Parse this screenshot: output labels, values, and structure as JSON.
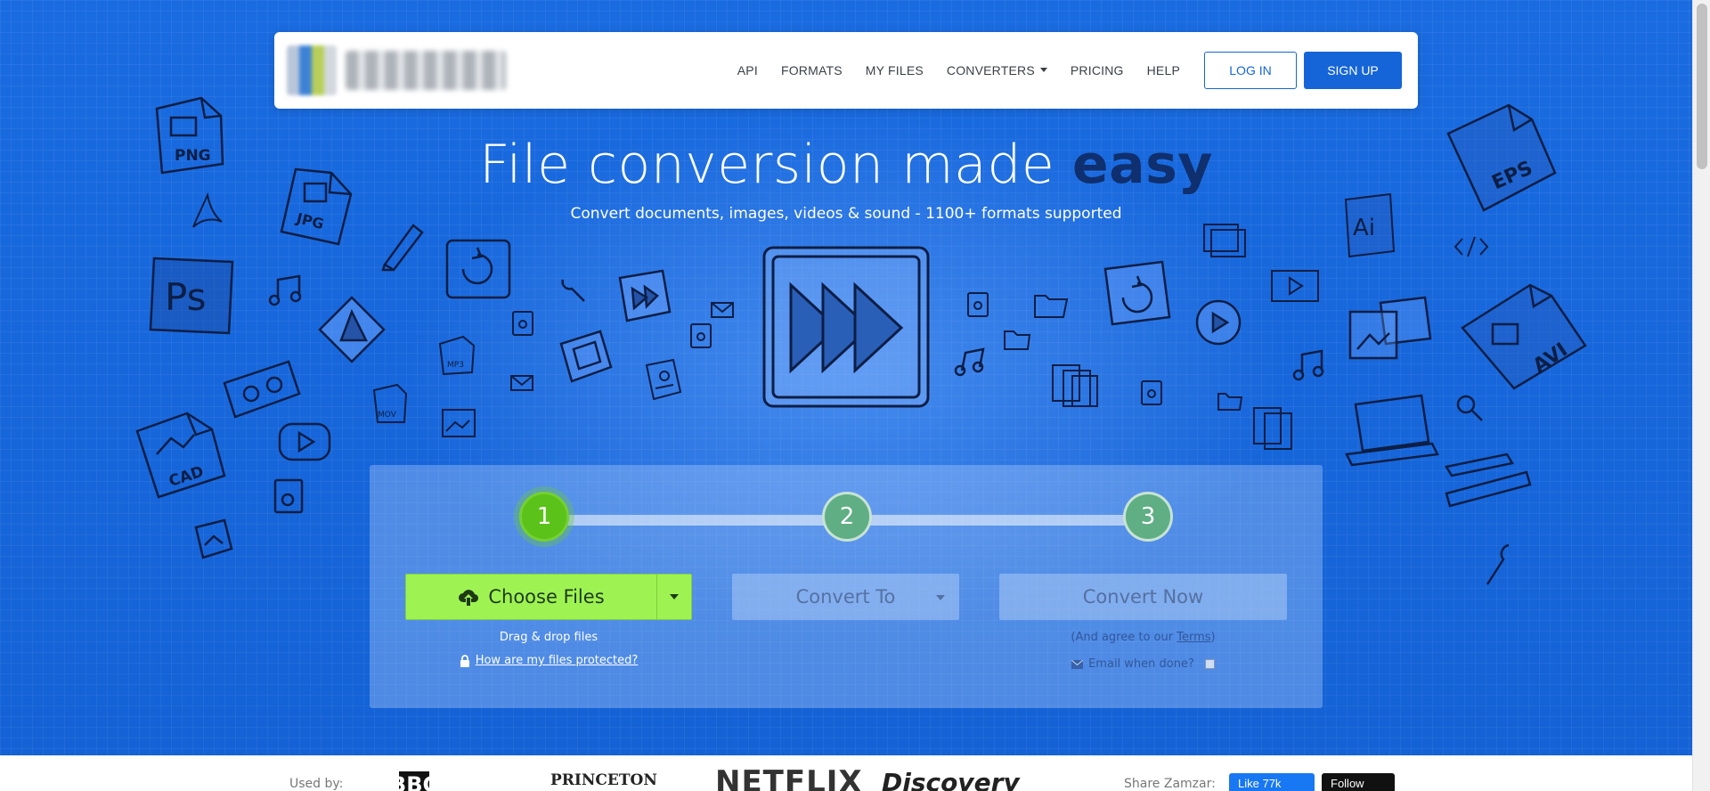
{
  "nav": {
    "links": [
      {
        "label": "API"
      },
      {
        "label": "FORMATS"
      },
      {
        "label": "MY FILES"
      },
      {
        "label": "CONVERTERS"
      },
      {
        "label": "PRICING"
      },
      {
        "label": "HELP"
      }
    ],
    "login_label": "LOG IN",
    "signup_label": "SIGN UP"
  },
  "hero": {
    "headline_main": "File conversion made",
    "headline_emphasis": "easy",
    "subheadline": "Convert documents, images, videos & sound - 1100+ formats supported"
  },
  "doodles": {
    "png": "PNG",
    "jpg": "JPG",
    "ps": "Ps",
    "cad": "CAD",
    "eps": "EPS",
    "ai": "Ai",
    "avi": "AVI",
    "mp3": "MP3",
    "mov": "MOV"
  },
  "converter": {
    "steps": [
      "1",
      "2",
      "3"
    ],
    "choose_files_label": "Choose Files",
    "convert_to_label": "Convert To",
    "convert_now_label": "Convert Now",
    "drag_drop_text": "Drag & drop files",
    "protection_link": "How are my files protected?",
    "agree_prefix": "(And agree to our ",
    "terms_label": "Terms",
    "agree_suffix": ")",
    "email_label": "Email when done?"
  },
  "strip": {
    "used_by_label": "Used by:",
    "brands": [
      "BBC",
      "PRINCETON",
      "NETFLIX",
      "Discovery"
    ],
    "share_label": "Share Zamzar:",
    "fb_like_label": "Like 77k",
    "x_follow_label": "Follow"
  },
  "colors": {
    "brand_blue": "#1565d8",
    "choose_green": "#9ef353",
    "step_active": "#5bc219",
    "headline_emphasis": "#0f2f6e"
  }
}
